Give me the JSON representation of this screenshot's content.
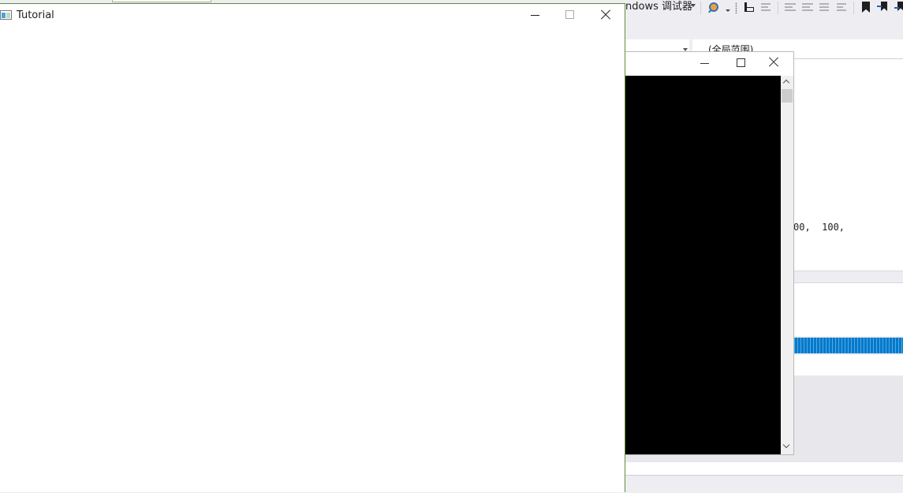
{
  "tutorial_window": {
    "title": "Tutorial"
  },
  "vs": {
    "debugger_label": "ndows 调试器",
    "scope_label": "(全局范围)",
    "code_fragment": "00,  100,"
  },
  "colors": {
    "progress": "#007acc",
    "window_border": "#5f8b3a",
    "console_bg": "#000000"
  }
}
